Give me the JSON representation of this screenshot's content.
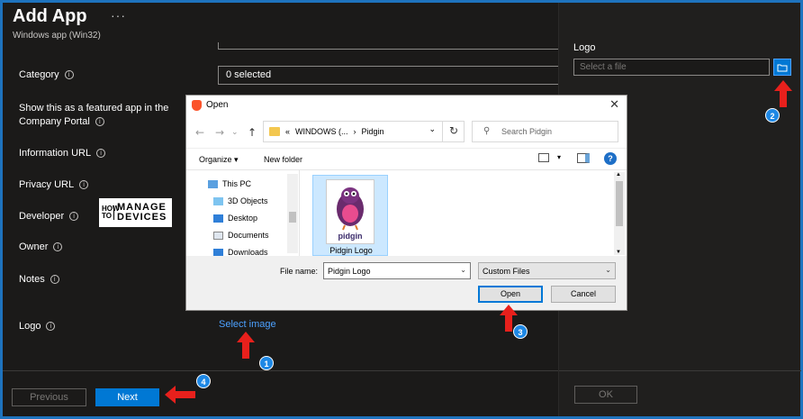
{
  "header": {
    "title": "Add App",
    "more": "···",
    "subtitle": "Windows app (Win32)"
  },
  "form": {
    "category_label": "Category",
    "category_value": "0 selected",
    "featured_label_line1": "Show this as a featured app in the",
    "featured_label_line2": "Company Portal",
    "info_url_label": "Information URL",
    "privacy_url_label": "Privacy URL",
    "developer_label": "Developer",
    "developer_logo": {
      "how": "HOW TO",
      "manage": "MANAGE",
      "devices": "DEVICES"
    },
    "owner_label": "Owner",
    "notes_label": "Notes",
    "logo_label": "Logo",
    "select_image_link": "Select image",
    "info_glyph": "i"
  },
  "footer": {
    "previous_label": "Previous",
    "next_label": "Next"
  },
  "right_panel": {
    "logo_label": "Logo",
    "file_placeholder": "Select a file",
    "ok_label": "OK"
  },
  "dialog": {
    "title": "Open",
    "close": "✕",
    "address": {
      "prefix": "«",
      "part1": "WINDOWS (...",
      "sep": "›",
      "part2": "Pidgin",
      "caret": "⌄"
    },
    "search_placeholder": "Search Pidgin",
    "organize_label": "Organize ▾",
    "new_folder_label": "New folder",
    "help": "?",
    "tree": [
      "This PC",
      "3D Objects",
      "Desktop",
      "Documents",
      "Downloads"
    ],
    "file": {
      "name": "Pidgin Logo",
      "thumb_text": "pidgin"
    },
    "file_name_label": "File name:",
    "file_name_value": "Pidgin Logo",
    "file_type_value": "Custom Files",
    "open_label": "Open",
    "cancel_label": "Cancel"
  },
  "annotations": {
    "badge1": "1",
    "badge2": "2",
    "badge3": "3",
    "badge4": "4",
    "color": "#e8201c"
  }
}
